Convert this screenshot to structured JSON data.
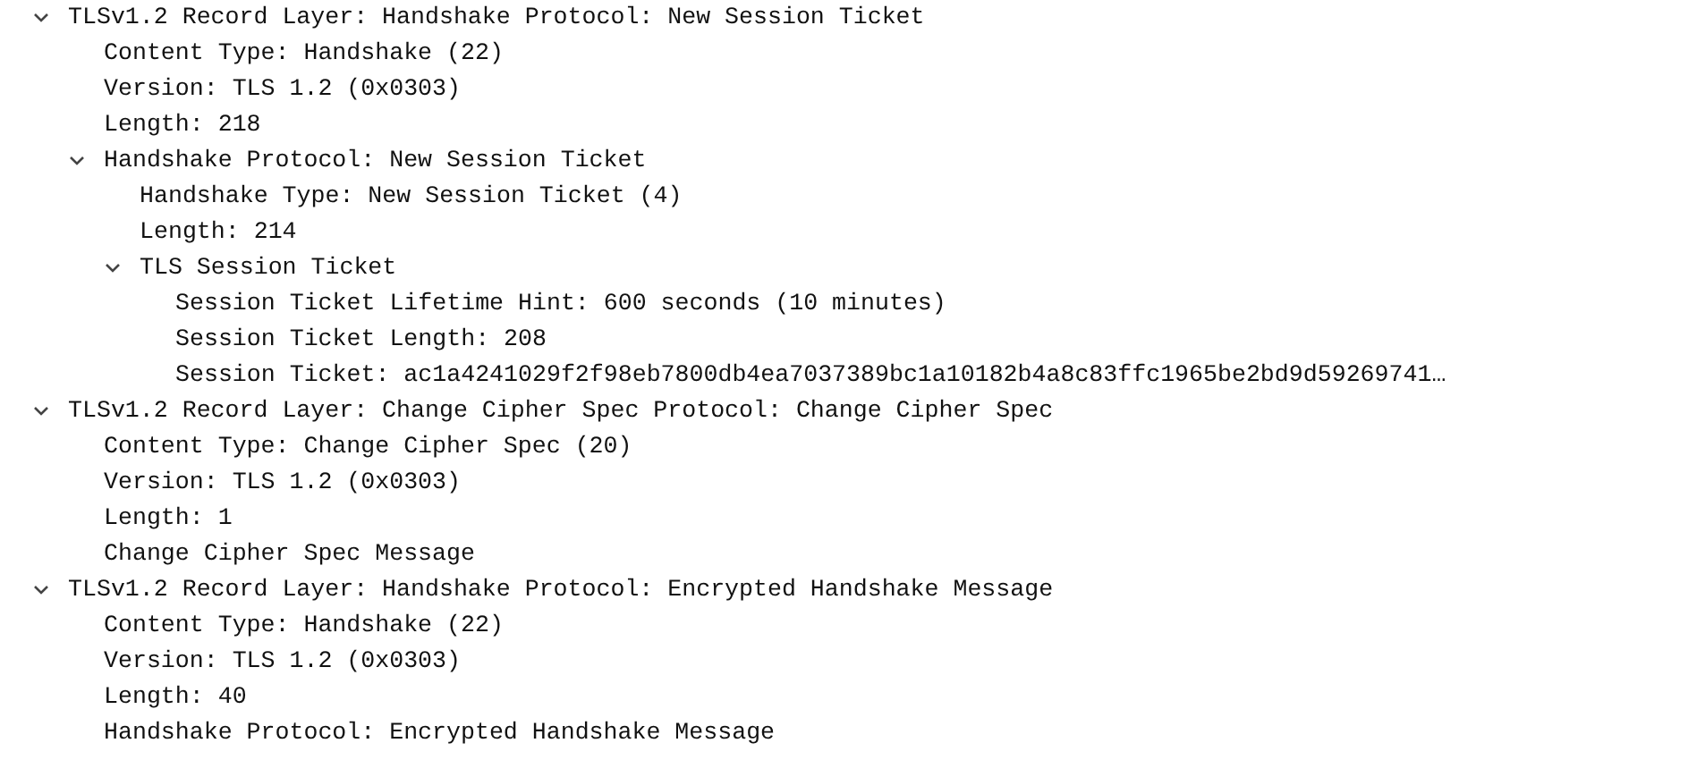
{
  "tree": [
    {
      "label": "TLSv1.2 Record Layer: Handshake Protocol: New Session Ticket",
      "expanded": true,
      "children": [
        {
          "label": "Content Type: Handshake (22)"
        },
        {
          "label": "Version: TLS 1.2 (0x0303)"
        },
        {
          "label": "Length: 218"
        },
        {
          "label": "Handshake Protocol: New Session Ticket",
          "expanded": true,
          "children": [
            {
              "label": "Handshake Type: New Session Ticket (4)"
            },
            {
              "label": "Length: 214"
            },
            {
              "label": "TLS Session Ticket",
              "expanded": true,
              "children": [
                {
                  "label": "Session Ticket Lifetime Hint: 600 seconds (10 minutes)"
                },
                {
                  "label": "Session Ticket Length: 208"
                },
                {
                  "label": "Session Ticket: ac1a4241029f2f98eb7800db4ea7037389bc1a10182b4a8c83ffc1965be2bd9d59269741…"
                }
              ]
            }
          ]
        }
      ]
    },
    {
      "label": "TLSv1.2 Record Layer: Change Cipher Spec Protocol: Change Cipher Spec",
      "expanded": true,
      "children": [
        {
          "label": "Content Type: Change Cipher Spec (20)"
        },
        {
          "label": "Version: TLS 1.2 (0x0303)"
        },
        {
          "label": "Length: 1"
        },
        {
          "label": "Change Cipher Spec Message"
        }
      ]
    },
    {
      "label": "TLSv1.2 Record Layer: Handshake Protocol: Encrypted Handshake Message",
      "expanded": true,
      "children": [
        {
          "label": "Content Type: Handshake (22)"
        },
        {
          "label": "Version: TLS 1.2 (0x0303)"
        },
        {
          "label": "Length: 40"
        },
        {
          "label": "Handshake Protocol: Encrypted Handshake Message"
        }
      ]
    }
  ]
}
